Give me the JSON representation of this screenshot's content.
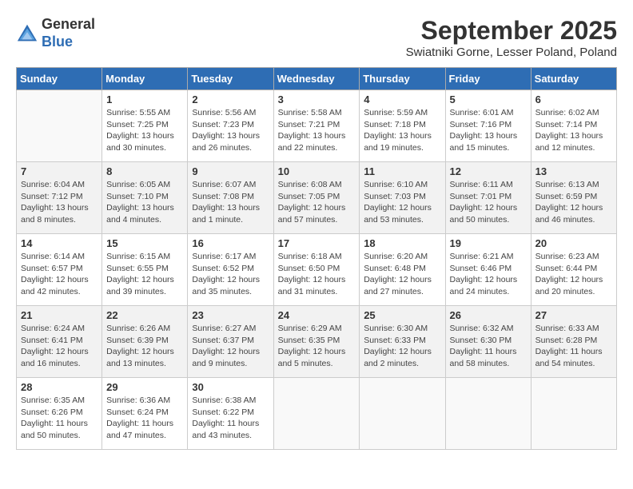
{
  "logo": {
    "general": "General",
    "blue": "Blue"
  },
  "title": "September 2025",
  "subtitle": "Swiatniki Gorne, Lesser Poland, Poland",
  "weekdays": [
    "Sunday",
    "Monday",
    "Tuesday",
    "Wednesday",
    "Thursday",
    "Friday",
    "Saturday"
  ],
  "weeks": [
    [
      {
        "day": "",
        "info": ""
      },
      {
        "day": "1",
        "info": "Sunrise: 5:55 AM\nSunset: 7:25 PM\nDaylight: 13 hours\nand 30 minutes."
      },
      {
        "day": "2",
        "info": "Sunrise: 5:56 AM\nSunset: 7:23 PM\nDaylight: 13 hours\nand 26 minutes."
      },
      {
        "day": "3",
        "info": "Sunrise: 5:58 AM\nSunset: 7:21 PM\nDaylight: 13 hours\nand 22 minutes."
      },
      {
        "day": "4",
        "info": "Sunrise: 5:59 AM\nSunset: 7:18 PM\nDaylight: 13 hours\nand 19 minutes."
      },
      {
        "day": "5",
        "info": "Sunrise: 6:01 AM\nSunset: 7:16 PM\nDaylight: 13 hours\nand 15 minutes."
      },
      {
        "day": "6",
        "info": "Sunrise: 6:02 AM\nSunset: 7:14 PM\nDaylight: 13 hours\nand 12 minutes."
      }
    ],
    [
      {
        "day": "7",
        "info": "Sunrise: 6:04 AM\nSunset: 7:12 PM\nDaylight: 13 hours\nand 8 minutes."
      },
      {
        "day": "8",
        "info": "Sunrise: 6:05 AM\nSunset: 7:10 PM\nDaylight: 13 hours\nand 4 minutes."
      },
      {
        "day": "9",
        "info": "Sunrise: 6:07 AM\nSunset: 7:08 PM\nDaylight: 13 hours\nand 1 minute."
      },
      {
        "day": "10",
        "info": "Sunrise: 6:08 AM\nSunset: 7:05 PM\nDaylight: 12 hours\nand 57 minutes."
      },
      {
        "day": "11",
        "info": "Sunrise: 6:10 AM\nSunset: 7:03 PM\nDaylight: 12 hours\nand 53 minutes."
      },
      {
        "day": "12",
        "info": "Sunrise: 6:11 AM\nSunset: 7:01 PM\nDaylight: 12 hours\nand 50 minutes."
      },
      {
        "day": "13",
        "info": "Sunrise: 6:13 AM\nSunset: 6:59 PM\nDaylight: 12 hours\nand 46 minutes."
      }
    ],
    [
      {
        "day": "14",
        "info": "Sunrise: 6:14 AM\nSunset: 6:57 PM\nDaylight: 12 hours\nand 42 minutes."
      },
      {
        "day": "15",
        "info": "Sunrise: 6:15 AM\nSunset: 6:55 PM\nDaylight: 12 hours\nand 39 minutes."
      },
      {
        "day": "16",
        "info": "Sunrise: 6:17 AM\nSunset: 6:52 PM\nDaylight: 12 hours\nand 35 minutes."
      },
      {
        "day": "17",
        "info": "Sunrise: 6:18 AM\nSunset: 6:50 PM\nDaylight: 12 hours\nand 31 minutes."
      },
      {
        "day": "18",
        "info": "Sunrise: 6:20 AM\nSunset: 6:48 PM\nDaylight: 12 hours\nand 27 minutes."
      },
      {
        "day": "19",
        "info": "Sunrise: 6:21 AM\nSunset: 6:46 PM\nDaylight: 12 hours\nand 24 minutes."
      },
      {
        "day": "20",
        "info": "Sunrise: 6:23 AM\nSunset: 6:44 PM\nDaylight: 12 hours\nand 20 minutes."
      }
    ],
    [
      {
        "day": "21",
        "info": "Sunrise: 6:24 AM\nSunset: 6:41 PM\nDaylight: 12 hours\nand 16 minutes."
      },
      {
        "day": "22",
        "info": "Sunrise: 6:26 AM\nSunset: 6:39 PM\nDaylight: 12 hours\nand 13 minutes."
      },
      {
        "day": "23",
        "info": "Sunrise: 6:27 AM\nSunset: 6:37 PM\nDaylight: 12 hours\nand 9 minutes."
      },
      {
        "day": "24",
        "info": "Sunrise: 6:29 AM\nSunset: 6:35 PM\nDaylight: 12 hours\nand 5 minutes."
      },
      {
        "day": "25",
        "info": "Sunrise: 6:30 AM\nSunset: 6:33 PM\nDaylight: 12 hours\nand 2 minutes."
      },
      {
        "day": "26",
        "info": "Sunrise: 6:32 AM\nSunset: 6:30 PM\nDaylight: 11 hours\nand 58 minutes."
      },
      {
        "day": "27",
        "info": "Sunrise: 6:33 AM\nSunset: 6:28 PM\nDaylight: 11 hours\nand 54 minutes."
      }
    ],
    [
      {
        "day": "28",
        "info": "Sunrise: 6:35 AM\nSunset: 6:26 PM\nDaylight: 11 hours\nand 50 minutes."
      },
      {
        "day": "29",
        "info": "Sunrise: 6:36 AM\nSunset: 6:24 PM\nDaylight: 11 hours\nand 47 minutes."
      },
      {
        "day": "30",
        "info": "Sunrise: 6:38 AM\nSunset: 6:22 PM\nDaylight: 11 hours\nand 43 minutes."
      },
      {
        "day": "",
        "info": ""
      },
      {
        "day": "",
        "info": ""
      },
      {
        "day": "",
        "info": ""
      },
      {
        "day": "",
        "info": ""
      }
    ]
  ]
}
